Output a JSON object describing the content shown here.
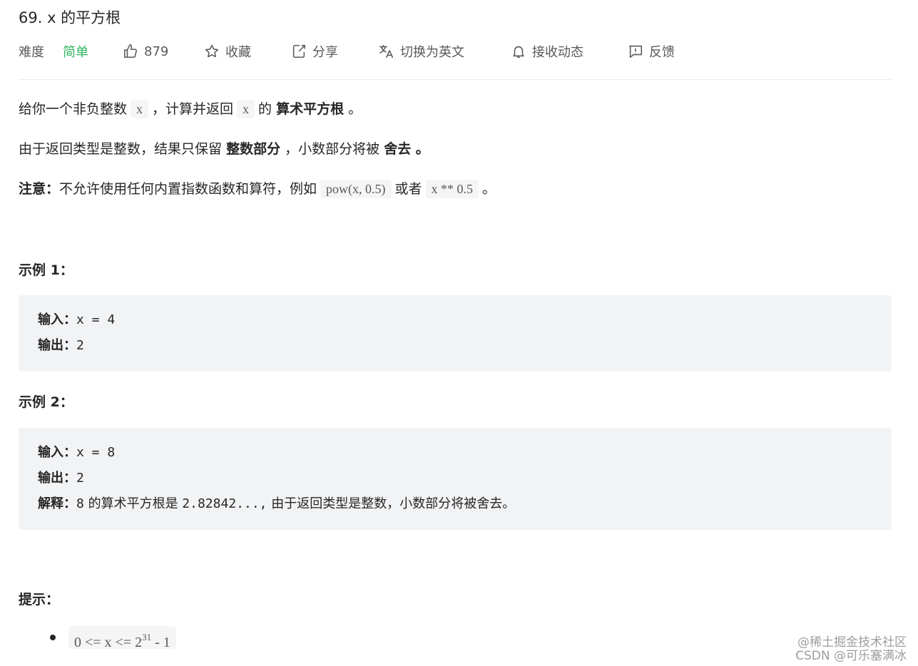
{
  "problem": {
    "title": "69. x 的平方根"
  },
  "meta": {
    "difficulty_label": "难度",
    "difficulty_value": "简单",
    "like_count": "879",
    "favorite_label": "收藏",
    "share_label": "分享",
    "translate_label": "切换为英文",
    "notify_label": "接收动态",
    "feedback_label": "反馈",
    "colors": {
      "easy": "#2db55d",
      "meta_text": "#595959"
    }
  },
  "description": {
    "p1": {
      "a": "给你一个非负整数",
      "code1": "x",
      "b": "，计算并返回",
      "code2": "x",
      "c": "的",
      "bold": "算术平方根",
      "d": "。"
    },
    "p2": {
      "a": "由于返回类型是整数，结果只保留",
      "bold1": "整数部分",
      "b": "，小数部分将被",
      "bold2": "舍去 。"
    },
    "p3": {
      "bold": "注意：",
      "a": "不允许使用任何内置指数函数和算符，例如",
      "code1": "pow(x, 0.5)",
      "b": "或者",
      "code2": "x ** 0.5",
      "c": "。"
    }
  },
  "examples": [
    {
      "heading": "示例 1：",
      "input_label": "输入：",
      "input_value": "x = 4",
      "output_label": "输出：",
      "output_value": "2"
    },
    {
      "heading": "示例 2：",
      "input_label": "输入：",
      "input_value": "x = 8",
      "output_label": "输出：",
      "output_value": "2",
      "explain_label": "解释：",
      "explain_a": "8",
      "explain_b": " 的算术平方根是 ",
      "explain_c": "2.82842...,",
      "explain_d": " 由于返回类型是整数，小数部分将被舍去。"
    }
  ],
  "hints": {
    "heading": "提示：",
    "constraint": {
      "left": "0 <= x <= 2",
      "exp": "31",
      "right": " - 1"
    }
  },
  "watermark": {
    "line1": "@稀土掘金技术社区",
    "line2": "CSDN @可乐塞满冰"
  }
}
